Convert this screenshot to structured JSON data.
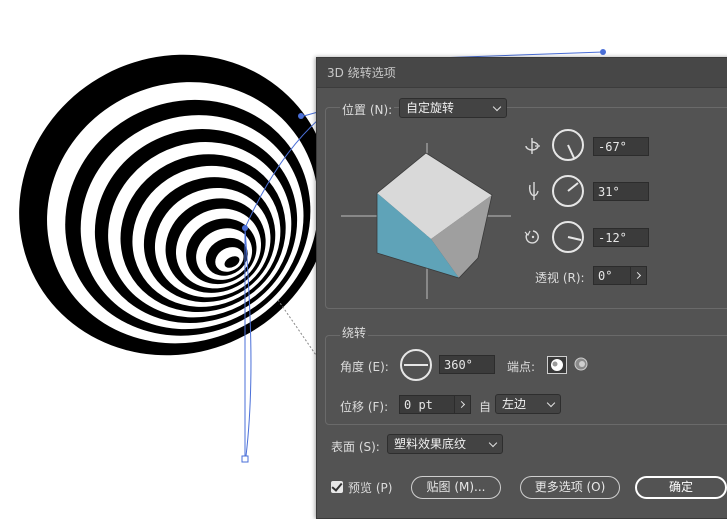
{
  "dialog": {
    "title": "3D 绕转选项",
    "position": {
      "label": "位置 (N):",
      "preset": "自定旋转",
      "rotate_x": "-67°",
      "rotate_y": "31°",
      "rotate_z": "-12°",
      "perspective_label": "透视 (R):",
      "perspective_value": "0°"
    },
    "revolve": {
      "section_label": "绕转",
      "angle_label": "角度 (E):",
      "angle_value": "360°",
      "cap_label": "端点:",
      "offset_label": "位移 (F):",
      "offset_value": "0 pt",
      "from_label": "自",
      "from_value": "左边"
    },
    "surface": {
      "label": "表面 (S):",
      "value": "塑料效果底纹"
    },
    "footer": {
      "preview_label": "预览 (P)",
      "preview_checked": true,
      "map_art_button": "贴图 (M)...",
      "more_options_button": "更多选项 (O)",
      "ok_button": "确定"
    }
  },
  "colors": {
    "dialog_bg": "#535353",
    "cube_top": "#d9d9d9",
    "cube_right": "#9f9f9f",
    "cube_bottom": "#5fa3b8",
    "path_blue": "#4a6fd8"
  }
}
